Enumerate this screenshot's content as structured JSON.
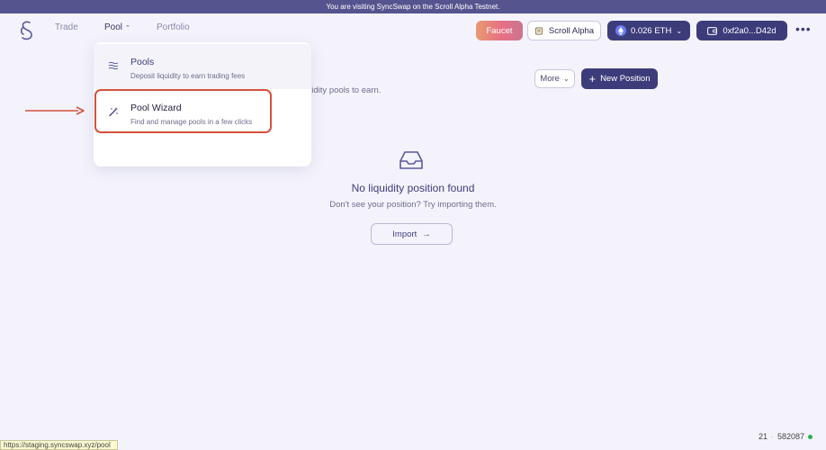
{
  "banner": {
    "text": "You are visiting SyncSwap on the Scroll Alpha Testnet."
  },
  "nav": {
    "trade": "Trade",
    "pool": "Pool",
    "portfolio": "Portfolio"
  },
  "header": {
    "faucet": "Faucet",
    "network": "Scroll Alpha",
    "balance": "0.026 ETH",
    "wallet": "0xf2a0...D42d"
  },
  "page": {
    "subtitle_visible": "uidity pools to earn.",
    "more": "More",
    "new_position": "New Position"
  },
  "empty_state": {
    "title": "No liquidity position found",
    "description": "Don't see your position? Try importing them.",
    "import": "Import"
  },
  "dropdown": {
    "items": [
      {
        "title": "Pools",
        "description": "Deposit liquidity to earn trading fees"
      },
      {
        "title": "Pool Wizard",
        "description": "Find and manage pools in a few clicks"
      }
    ]
  },
  "status_bar": {
    "url": "https://staging.syncswap.xyz/pool",
    "block_left": "21",
    "separator": "·",
    "block_number": "582087"
  },
  "colors": {
    "primary": "#3d3c7a",
    "background": "#f4f3fc",
    "highlight": "#d6513b",
    "status_online": "#2bb24c"
  }
}
